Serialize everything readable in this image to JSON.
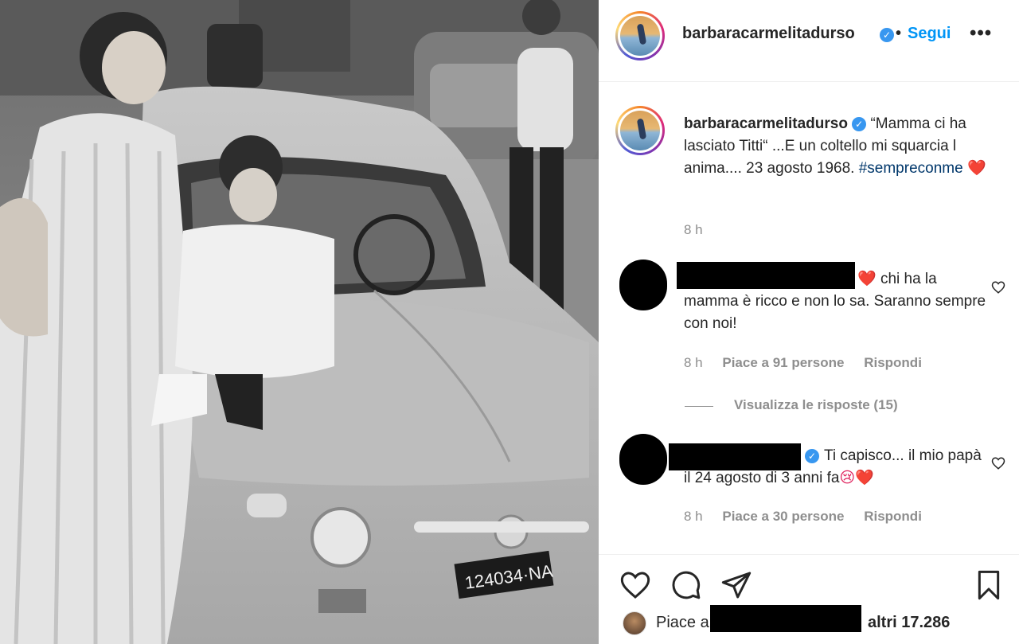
{
  "post": {
    "photo_alt": "vintage black and white photo",
    "plate": "124034·NA"
  },
  "header": {
    "username": "barbaracarmelitadurso",
    "dot": "•",
    "follow_label": "Segui",
    "more_label": "•••"
  },
  "caption": {
    "username": "barbaracarmelitadurso",
    "text": "“Mamma ci ha lasciato Titti“ ...E un coltello mi squarcia l anima.... 23 agosto 1968.",
    "hashtag": "#sempreconme",
    "emoji": "❤️",
    "time": "8 h"
  },
  "comments": [
    {
      "text": "chi ha la mamma è ricco e non lo sa. Saranno sempre con noi!",
      "emoji": "❤️",
      "time": "8 h",
      "likes": "Piace a 91 persone",
      "reply": "Rispondi"
    },
    {
      "text": "Ti capisco... il mio papà il 24 agosto di 3 anni fa",
      "emoji": "😢❤️",
      "time": "8 h",
      "likes": "Piace a 30 persone",
      "reply": "Rispondi"
    }
  ],
  "view_replies": "Visualizza le risposte (15)",
  "likes_summary": {
    "prefix": "Piace a",
    "suffix": "altri 17.286"
  },
  "colors": {
    "accent": "#0095f6",
    "verified": "#3897f0",
    "secondary_text": "#8e8e8e",
    "heart": "#e0245e"
  },
  "icons": [
    "verified-icon",
    "more-icon",
    "heart-icon",
    "comment-icon",
    "share-icon",
    "bookmark-icon"
  ]
}
